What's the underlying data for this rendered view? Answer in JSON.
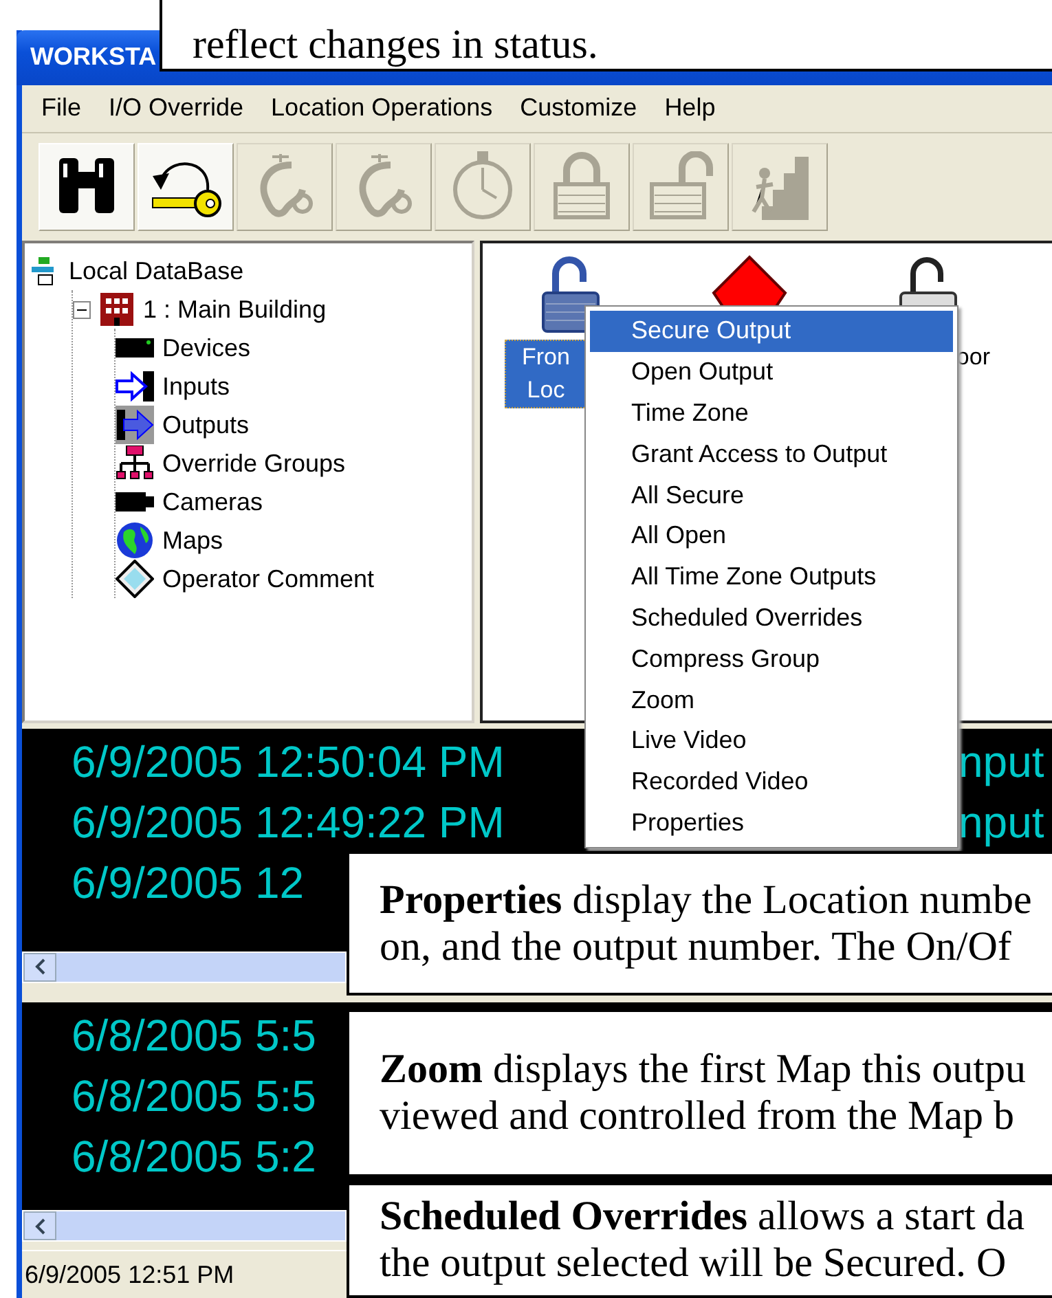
{
  "window": {
    "title": "WORKSTA"
  },
  "menu": [
    "File",
    "I/O Override",
    "Location Operations",
    "Customize",
    "Help"
  ],
  "toolbar": [
    {
      "kind": "binoculars",
      "disabled": false
    },
    {
      "kind": "key",
      "disabled": false
    },
    {
      "kind": "ear",
      "disabled": true
    },
    {
      "kind": "ear",
      "disabled": true
    },
    {
      "kind": "stopwatch",
      "disabled": true
    },
    {
      "kind": "lock",
      "disabled": true
    },
    {
      "kind": "unlock",
      "disabled": true
    },
    {
      "kind": "exit",
      "disabled": true
    }
  ],
  "tree": {
    "label": "Local DataBase",
    "kind": "database",
    "children": [
      {
        "label": "1 : Main Building",
        "kind": "building",
        "expanded": true,
        "children": [
          {
            "label": "Devices",
            "kind": "device"
          },
          {
            "label": "Inputs",
            "kind": "input"
          },
          {
            "label": "Outputs",
            "kind": "output"
          },
          {
            "label": "Override Groups",
            "kind": "group"
          },
          {
            "label": "Cameras",
            "kind": "camera"
          },
          {
            "label": "Maps",
            "kind": "globe"
          },
          {
            "label": "Operator Comment",
            "kind": "comment"
          }
        ]
      }
    ]
  },
  "outputs": [
    {
      "kind": "open-lock",
      "label_lines": [
        "Fron",
        "Loc"
      ],
      "selected": true
    },
    {
      "kind": "alarm",
      "selected": false
    },
    {
      "kind": "grey-lock",
      "label_lines": [
        "oor"
      ],
      "selected": false
    }
  ],
  "context_menu": [
    {
      "label": "Secure Output",
      "selected": true
    },
    {
      "label": "Open Output",
      "selected": false
    },
    {
      "label": "Time Zone",
      "selected": false
    },
    {
      "label": "Grant Access to Output",
      "selected": false
    },
    {
      "label": "All Secure",
      "selected": false
    },
    {
      "label": "All Open",
      "selected": false
    },
    {
      "label": "All Time Zone Outputs",
      "selected": false
    },
    {
      "label": "Scheduled Overrides",
      "selected": false
    },
    {
      "label": "Compress Group",
      "selected": false
    },
    {
      "label": "Zoom",
      "selected": false
    },
    {
      "label": "Live Video",
      "selected": false
    },
    {
      "label": "Recorded Video",
      "selected": false
    },
    {
      "label": "Properties",
      "selected": false
    }
  ],
  "event_log": {
    "rows": [
      {
        "time": "6/9/2005 12:50:04 PM",
        "column_2": "nput"
      },
      {
        "time": "6/9/2005 12:49:22 PM",
        "column_2": "nput"
      },
      {
        "time": "6/9/2005 12"
      }
    ]
  },
  "alarm_log": {
    "rows": [
      {
        "time": "6/8/2005 5:5"
      },
      {
        "time": "6/8/2005 5:5"
      },
      {
        "time": "6/8/2005 5:2"
      }
    ]
  },
  "status_bar": {
    "text": "6/9/2005 12:51 PM"
  },
  "callouts": [
    {
      "text": "reflect changes in status."
    },
    {
      "text": "**Properties** display the Location numbe\non, and the output number. The On/Of"
    },
    {
      "text": "**Zoom** displays the first Map this outpu\nviewed and controlled from the Map b"
    },
    {
      "text": "**Scheduled Overrides** allows a start da\nthe output selected will be Secured. O"
    }
  ]
}
